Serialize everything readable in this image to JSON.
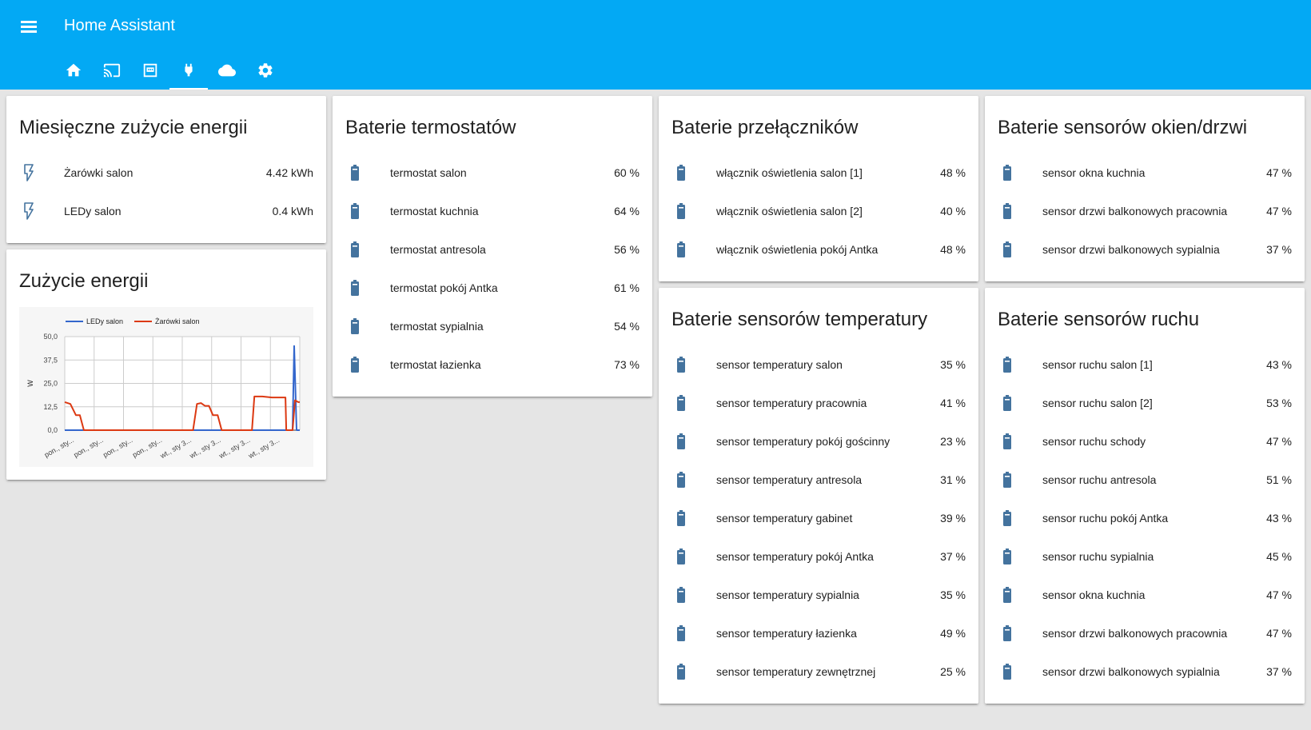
{
  "app": {
    "title": "Home Assistant"
  },
  "tabs": [
    {
      "icon": "home-icon"
    },
    {
      "icon": "cast-icon"
    },
    {
      "icon": "router-icon"
    },
    {
      "icon": "power-plug-icon",
      "active": true
    },
    {
      "icon": "cloud-icon"
    },
    {
      "icon": "settings-icon"
    }
  ],
  "energy_monthly": {
    "title": "Miesięczne zużycie energii",
    "items": [
      {
        "label": "Żarówki salon",
        "value": "4.42 kWh",
        "icon": "flash-icon"
      },
      {
        "label": "LEDy salon",
        "value": "0.4 kWh",
        "icon": "flash-icon"
      }
    ]
  },
  "energy_usage": {
    "title": "Zużycie energii"
  },
  "thermostats": {
    "title": "Baterie termostatów",
    "items": [
      {
        "label": "termostat salon",
        "value": "60 %",
        "icon": "battery-icon"
      },
      {
        "label": "termostat kuchnia",
        "value": "64 %",
        "icon": "battery-icon"
      },
      {
        "label": "termostat antresola",
        "value": "56 %",
        "icon": "battery-icon"
      },
      {
        "label": "termostat pokój Antka",
        "value": "61 %",
        "icon": "battery-icon"
      },
      {
        "label": "termostat sypialnia",
        "value": "54 %",
        "icon": "battery-icon"
      },
      {
        "label": "termostat łazienka",
        "value": "73 %",
        "icon": "battery-icon"
      }
    ]
  },
  "switches": {
    "title": "Baterie przełączników",
    "items": [
      {
        "label": "włącznik oświetlenia salon [1]",
        "value": "48 %",
        "icon": "battery-icon"
      },
      {
        "label": "włącznik oświetlenia salon [2]",
        "value": "40 %",
        "icon": "battery-icon"
      },
      {
        "label": "włącznik oświetlenia pokój Antka",
        "value": "48 %",
        "icon": "battery-icon"
      }
    ]
  },
  "windows": {
    "title": "Baterie sensorów okien/drzwi",
    "items": [
      {
        "label": "sensor okna kuchnia",
        "value": "47 %",
        "icon": "battery-icon"
      },
      {
        "label": "sensor drzwi balkonowych pracownia",
        "value": "47 %",
        "icon": "battery-icon"
      },
      {
        "label": "sensor drzwi balkonowych sypialnia",
        "value": "37 %",
        "icon": "battery-icon"
      }
    ]
  },
  "temperature": {
    "title": "Baterie sensorów temperatury",
    "items": [
      {
        "label": "sensor temperatury salon",
        "value": "35 %",
        "icon": "battery-icon"
      },
      {
        "label": "sensor temperatury pracownia",
        "value": "41 %",
        "icon": "battery-icon"
      },
      {
        "label": "sensor temperatury pokój gościnny",
        "value": "23 %",
        "icon": "battery-icon"
      },
      {
        "label": "sensor temperatury antresola",
        "value": "31 %",
        "icon": "battery-icon"
      },
      {
        "label": "sensor temperatury gabinet",
        "value": "39 %",
        "icon": "battery-icon"
      },
      {
        "label": "sensor temperatury pokój Antka",
        "value": "37 %",
        "icon": "battery-icon"
      },
      {
        "label": "sensor temperatury sypialnia",
        "value": "35 %",
        "icon": "battery-icon"
      },
      {
        "label": "sensor temperatury łazienka",
        "value": "49 %",
        "icon": "battery-icon"
      },
      {
        "label": "sensor temperatury zewnętrznej",
        "value": "25 %",
        "icon": "battery-icon"
      }
    ]
  },
  "motion": {
    "title": "Baterie sensorów ruchu",
    "items": [
      {
        "label": "sensor ruchu salon [1]",
        "value": "43 %",
        "icon": "battery-icon"
      },
      {
        "label": "sensor ruchu salon [2]",
        "value": "53 %",
        "icon": "battery-icon"
      },
      {
        "label": "sensor ruchu schody",
        "value": "47 %",
        "icon": "battery-icon"
      },
      {
        "label": "sensor ruchu antresola",
        "value": "51 %",
        "icon": "battery-icon"
      },
      {
        "label": "sensor ruchu pokój Antka",
        "value": "43 %",
        "icon": "battery-icon"
      },
      {
        "label": "sensor ruchu sypialnia",
        "value": "45 %",
        "icon": "battery-icon"
      },
      {
        "label": "sensor okna kuchnia",
        "value": "47 %",
        "icon": "battery-icon"
      },
      {
        "label": "sensor drzwi balkonowych pracownia",
        "value": "47 %",
        "icon": "battery-icon"
      },
      {
        "label": "sensor drzwi balkonowych sypialnia",
        "value": "37 %",
        "icon": "battery-icon"
      }
    ]
  },
  "colors": {
    "toolbar": "#03a9f4",
    "icon": "#44739e",
    "background": "#e5e5e5"
  },
  "chart_data": {
    "type": "line",
    "ylabel": "W",
    "ylim": [
      0,
      50
    ],
    "yticks": [
      "50,0",
      "37,5",
      "25,0",
      "12,5",
      "0,0"
    ],
    "xlim": [
      0,
      29.5
    ],
    "xticks": [
      "pon., sty...",
      "pon., sty...",
      "pon., sty...",
      "pon., sty...",
      "wt., sty 3...",
      "wt., sty 3...",
      "wt., sty 3...",
      "wt., sty 3..."
    ],
    "legend_position": "top",
    "grid": true,
    "series": [
      {
        "name": "LEDy salon",
        "color": "#3366cc",
        "points": [
          [
            0,
            0
          ],
          [
            28.6,
            0
          ],
          [
            28.8,
            45
          ],
          [
            29.1,
            0
          ],
          [
            29.5,
            0
          ]
        ]
      },
      {
        "name": "Żarówki salon",
        "color": "#dc3912",
        "points": [
          [
            0,
            15
          ],
          [
            0.7,
            14
          ],
          [
            1.4,
            8
          ],
          [
            1.9,
            8
          ],
          [
            2.4,
            0
          ],
          [
            16.1,
            0
          ],
          [
            16.6,
            14
          ],
          [
            17.1,
            14.5
          ],
          [
            17.6,
            13
          ],
          [
            18.1,
            13
          ],
          [
            18.6,
            8
          ],
          [
            19.2,
            8
          ],
          [
            19.7,
            0
          ],
          [
            23.5,
            0
          ],
          [
            23.8,
            18
          ],
          [
            24.8,
            18
          ],
          [
            26,
            17.5
          ],
          [
            27.7,
            17.5
          ],
          [
            27.8,
            0
          ],
          [
            28.6,
            0
          ],
          [
            28.9,
            16
          ],
          [
            29.3,
            15
          ],
          [
            29.5,
            15
          ]
        ]
      }
    ]
  }
}
